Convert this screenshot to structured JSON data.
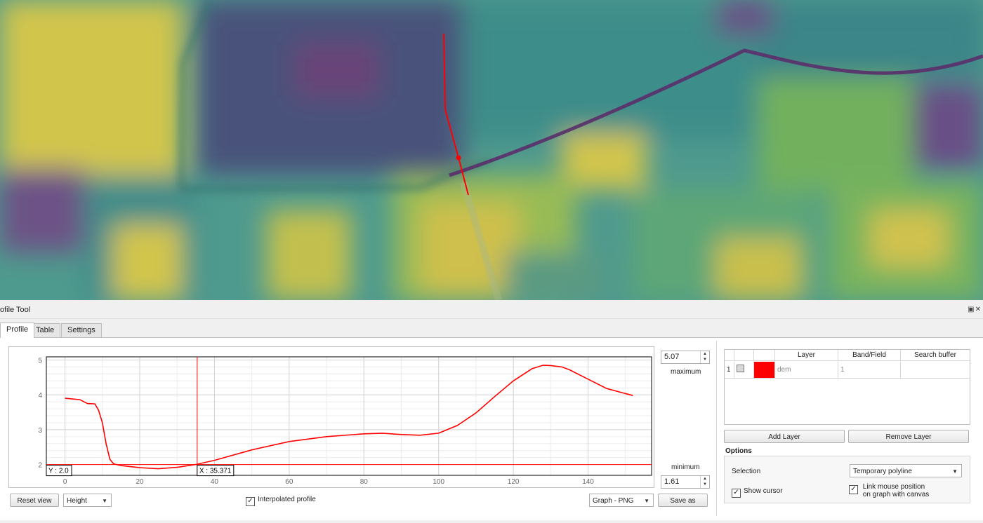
{
  "dock_title": "ofile Tool",
  "dock_controls": "▣✕",
  "tabs": [
    {
      "label": "Profile",
      "active": true
    },
    {
      "label": "Table",
      "active": false
    },
    {
      "label": "Settings",
      "active": false
    }
  ],
  "profile": {
    "max_value": "5.07",
    "max_label": "maximum",
    "min_value": "1.61",
    "min_label": "minimum",
    "cursor_y_label": "Y : 2.0",
    "cursor_x_label": "X : 35.371",
    "reset_view_label": "Reset view",
    "mode_select": "Height",
    "interpolated_label": "Interpolated profile",
    "interpolated_checked": true,
    "export_select": "Graph - PNG",
    "save_as_label": "Save as"
  },
  "chart_data": {
    "type": "line",
    "x_ticks": [
      0,
      20,
      40,
      60,
      80,
      100,
      120,
      140
    ],
    "y_ticks": [
      2,
      3,
      4,
      5
    ],
    "xlim": [
      -5,
      157
    ],
    "ylim": [
      1.69,
      5.09
    ],
    "cursor": {
      "x": 35.371,
      "y": 2.0
    },
    "line_color": "#ff0000",
    "series": [
      {
        "x": [
          0,
          2,
          4,
          6,
          8,
          9,
          10,
          11,
          12,
          13,
          15,
          20,
          25,
          30,
          35,
          40,
          50,
          60,
          70,
          80,
          85,
          90,
          95,
          100,
          105,
          110,
          115,
          120,
          125,
          128,
          130,
          133,
          135,
          140,
          145,
          152
        ],
        "y": [
          3.9,
          3.88,
          3.86,
          3.75,
          3.74,
          3.55,
          3.2,
          2.6,
          2.15,
          2.02,
          1.97,
          1.91,
          1.88,
          1.92,
          2.0,
          2.12,
          2.42,
          2.66,
          2.8,
          2.88,
          2.9,
          2.86,
          2.84,
          2.9,
          3.12,
          3.48,
          3.95,
          4.4,
          4.75,
          4.85,
          4.84,
          4.8,
          4.72,
          4.45,
          4.18,
          3.98
        ]
      }
    ]
  },
  "layers": {
    "columns": [
      "",
      "",
      "Layer",
      "Band/Field",
      "Search buffer"
    ],
    "rows": [
      {
        "index": "1",
        "color": "#ff0000",
        "layer": "dem",
        "band": "1",
        "buffer": ""
      }
    ],
    "add_label": "Add Layer",
    "remove_label": "Remove Layer"
  },
  "options": {
    "title": "Options",
    "selection_label": "Selection",
    "selection_value": "Temporary polyline",
    "show_cursor_label": "Show cursor",
    "show_cursor_checked": true,
    "link_label_1": "Link mouse position",
    "link_label_2": "on graph with canvas",
    "link_checked": true
  }
}
